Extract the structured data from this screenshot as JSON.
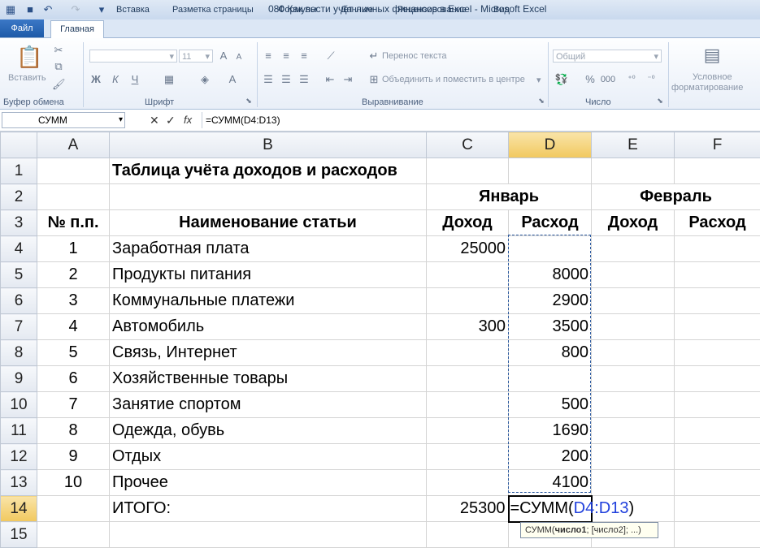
{
  "window": {
    "title": "080 Как вести учёт личных финансов в Excel  -  Microsoft Excel"
  },
  "ribbon": {
    "tabs": [
      "Файл",
      "Главная",
      "Вставка",
      "Разметка страницы",
      "Формулы",
      "Данные",
      "Рецензирование",
      "Вид"
    ],
    "paste_label": "Вставить",
    "font_size": "11",
    "wrap_text": "Перенос текста",
    "merge_center": "Объединить и поместить в центре",
    "number_format": "Общий",
    "conditional_formatting_1": "Условное",
    "conditional_formatting_2": "форматирование",
    "groups": {
      "clipboard": "Буфер обмена",
      "font": "Шрифт",
      "alignment": "Выравнивание",
      "number": "Число"
    },
    "bold_label": "Ж",
    "italic_label": "К",
    "underline_label": "Ч"
  },
  "formula_bar": {
    "name_box": "СУММ",
    "fx": "fx",
    "formula": "=СУММ(D4:D13)"
  },
  "columns": [
    "A",
    "B",
    "C",
    "D",
    "E",
    "F"
  ],
  "rows": [
    "1",
    "2",
    "3",
    "4",
    "5",
    "6",
    "7",
    "8",
    "9",
    "10",
    "11",
    "12",
    "13",
    "14",
    "15"
  ],
  "sheet": {
    "title": "Таблица учёта доходов и расходов",
    "january": "Январь",
    "february": "Февраль",
    "h_num": "№ п.п.",
    "h_name": "Наименование статьи",
    "h_income": "Доход",
    "h_expense": "Расход",
    "items": [
      {
        "n": "1",
        "name": "Заработная плата",
        "income": "25000",
        "expense": ""
      },
      {
        "n": "2",
        "name": "Продукты питания",
        "income": "",
        "expense": "8000"
      },
      {
        "n": "3",
        "name": "Коммунальные платежи",
        "income": "",
        "expense": "2900"
      },
      {
        "n": "4",
        "name": "Автомобиль",
        "income": "300",
        "expense": "3500"
      },
      {
        "n": "5",
        "name": "Связь, Интернет",
        "income": "",
        "expense": "800"
      },
      {
        "n": "6",
        "name": "Хозяйственные товары",
        "income": "",
        "expense": ""
      },
      {
        "n": "7",
        "name": "Занятие спортом",
        "income": "",
        "expense": "500"
      },
      {
        "n": "8",
        "name": "Одежда, обувь",
        "income": "",
        "expense": "1690"
      },
      {
        "n": "9",
        "name": "Отдых",
        "income": "",
        "expense": "200"
      },
      {
        "n": "10",
        "name": "Прочее",
        "income": "",
        "expense": "4100"
      }
    ],
    "total_label": "ИТОГО:",
    "total_income": "25300",
    "edit_prefix": "=СУММ(",
    "edit_ref": "D4:D13",
    "edit_suffix": ")"
  },
  "tooltip": {
    "func": "СУММ(",
    "arg1": "число1",
    "rest": "; [число2]; ...)"
  }
}
